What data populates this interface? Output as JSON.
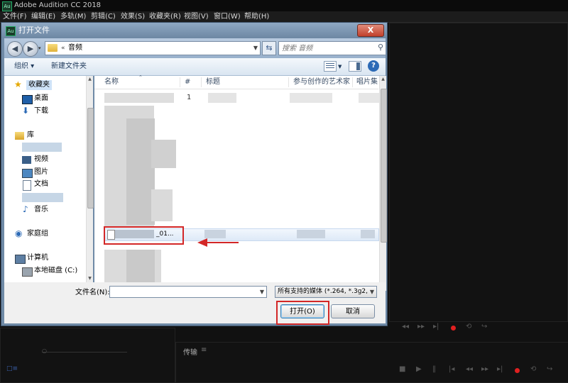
{
  "app": {
    "title": "Adobe Audition CC 2018",
    "logo_text": "Au",
    "menu": [
      "文件(F)",
      "编辑(E)",
      "多轨(M)",
      "剪辑(C)",
      "效果(S)",
      "收藏夹(R)",
      "视图(V)",
      "窗口(W)",
      "帮助(H)"
    ],
    "bottom_panel_label": "传输",
    "bottom_panel_icon": "hamburger-icon"
  },
  "dialog": {
    "title": "打开文件",
    "close_glyph": "X",
    "address": {
      "path_sep": "«",
      "path": "音频"
    },
    "search": {
      "placeholder": "搜索 音频"
    },
    "toolbar": {
      "organize": "组织 ▾",
      "new_folder": "新建文件夹"
    },
    "nav": {
      "favorites": "收藏夹",
      "desktop": "桌面",
      "downloads": "下载",
      "libraries": "库",
      "videos": "视频",
      "pictures": "图片",
      "documents": "文档",
      "music": "音乐",
      "homegroup": "家庭组",
      "computer": "计算机",
      "local_disk": "本地磁盘 (C:)"
    },
    "columns": {
      "name": "名称",
      "num": "#",
      "title": "标题",
      "artist": "参与创作的艺术家",
      "album": "唱片集"
    },
    "rows": [
      {
        "num": "1"
      },
      {
        "name_suffix": "_01...",
        "selected": true
      }
    ],
    "filename_label": "文件名(N):",
    "filename_value": "",
    "filetype": "所有支持的媒体 (*.264, *.3g2,",
    "open_button": "打开(O)",
    "cancel_button": "取消"
  },
  "colors": {
    "highlight": "#d32727",
    "accent": "#2c6ab6"
  }
}
